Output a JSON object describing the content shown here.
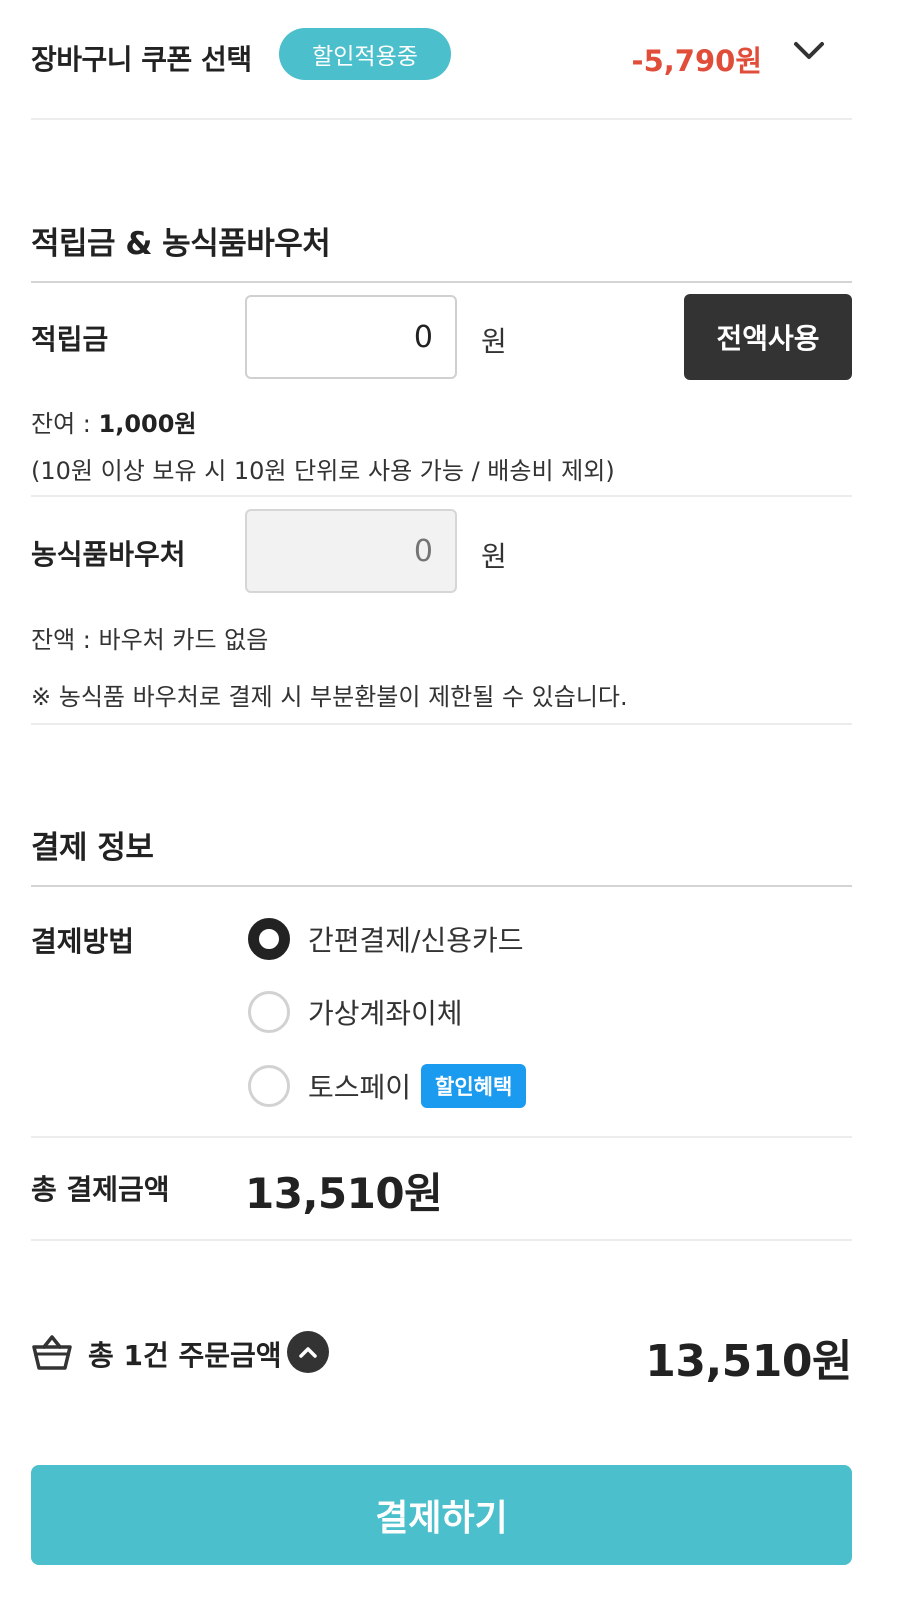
{
  "coupon": {
    "title": "장바구니 쿠폰 선택",
    "badge": "할인적용중",
    "amount": "-5,790원"
  },
  "points_section": {
    "title": "적립금 & 농식품바우처",
    "points": {
      "label": "적립금",
      "value": "0",
      "unit": "원",
      "full_use_label": "전액사용",
      "balance_label": "잔여 : ",
      "balance_value": "1,000원",
      "note": "(10원 이상 보유 시 10원 단위로 사용 가능 / 배송비 제외)"
    },
    "voucher": {
      "label": "농식품바우처",
      "placeholder": "0",
      "unit": "원",
      "balance_text": "잔액 : 바우처 카드 없음",
      "notice": "※ 농식품 바우처로 결제 시 부분환불이 제한될 수 있습니다."
    }
  },
  "payment": {
    "title": "결제 정보",
    "method_label": "결제방법",
    "methods": [
      {
        "label": "간편결제/신용카드",
        "selected": true
      },
      {
        "label": "가상계좌이체",
        "selected": false
      },
      {
        "label": "토스페이",
        "selected": false,
        "badge": "할인혜택"
      }
    ],
    "total_label": "총 결제금액",
    "total_value": "13,510원"
  },
  "order_summary": {
    "label": "총 1건 주문금액",
    "amount": "13,510원"
  },
  "checkout_button": "결제하기",
  "colors": {
    "accent": "#4bbfcb",
    "discount_red": "#e04e3a",
    "dark_button": "#333333",
    "toss_blue": "#1a9bf0"
  }
}
